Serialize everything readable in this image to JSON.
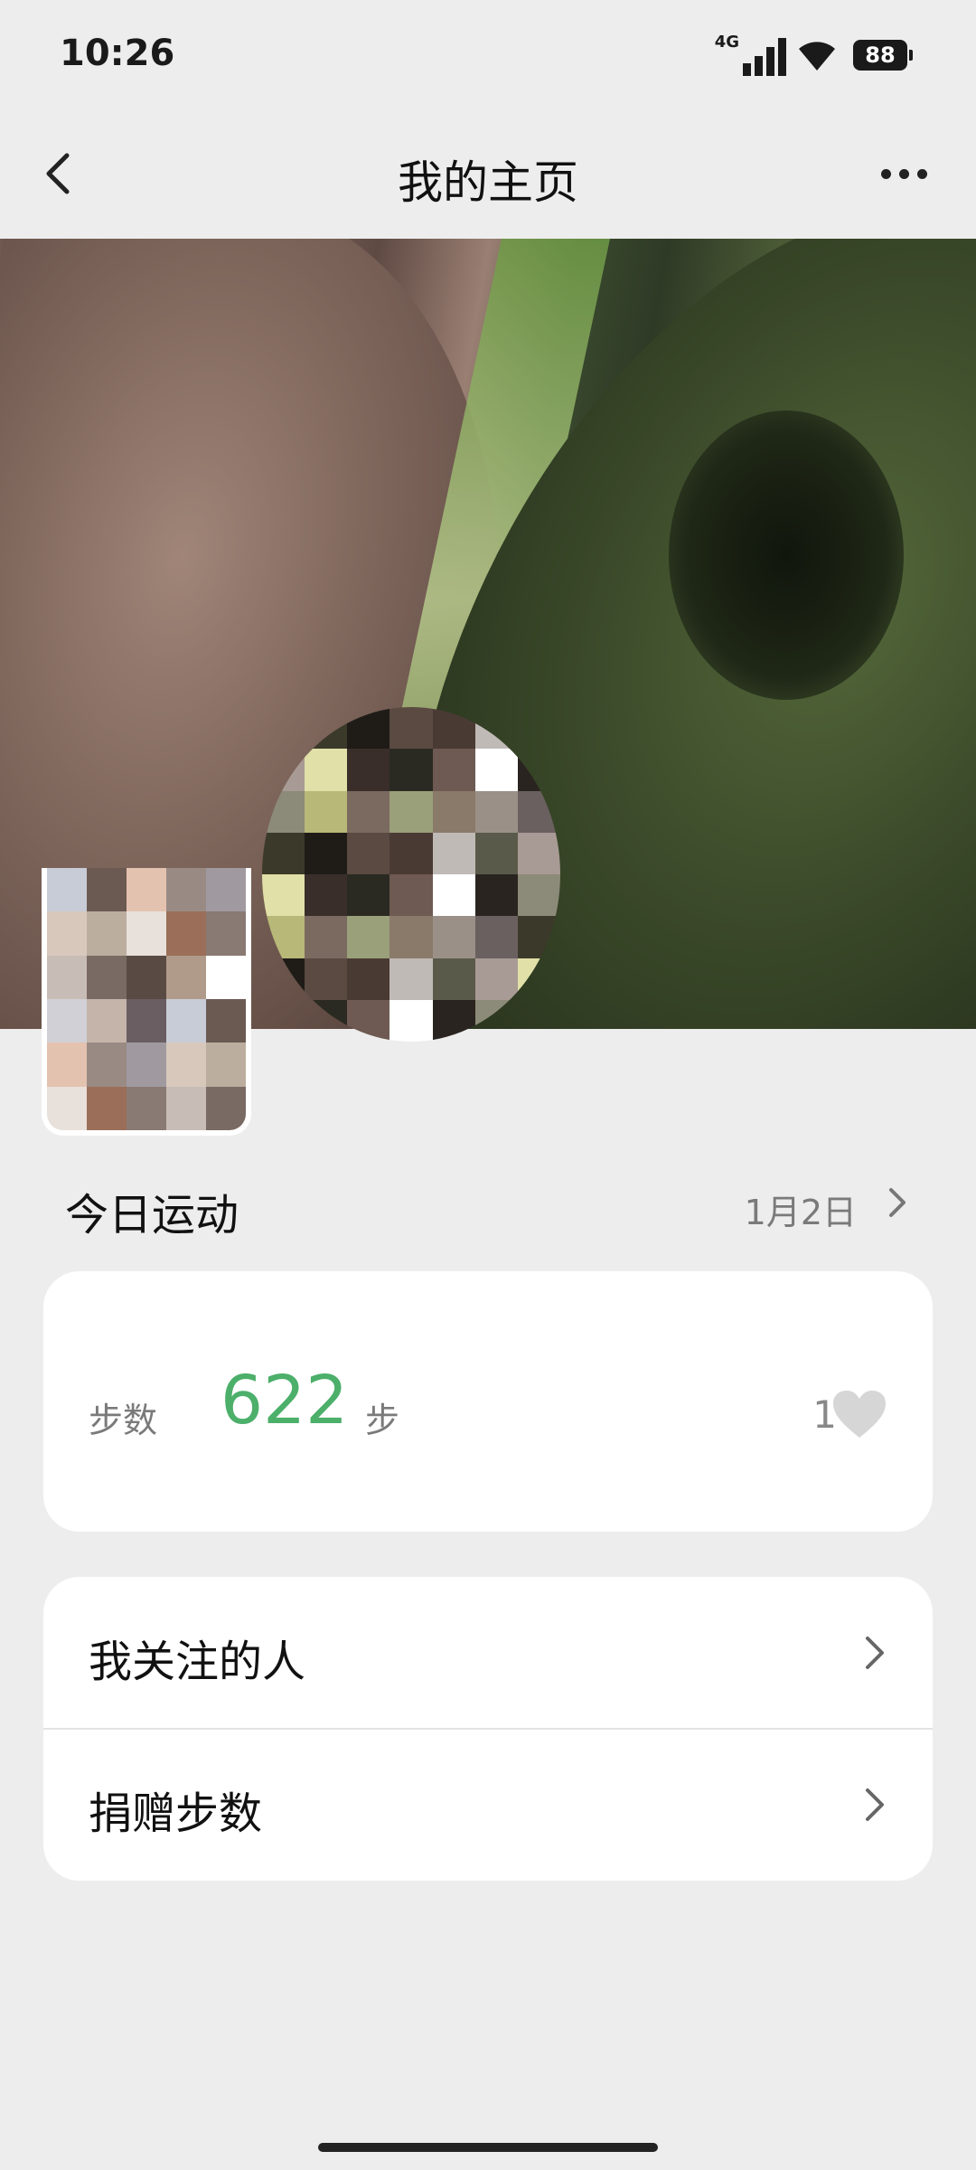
{
  "status_bar": {
    "time": "10:26",
    "network": "4G",
    "battery": "88"
  },
  "nav": {
    "title": "我的主页"
  },
  "section": {
    "title": "今日运动",
    "date": "1月2日"
  },
  "steps": {
    "label": "步数",
    "value": "622",
    "unit": "步",
    "likes": "1"
  },
  "menu": [
    {
      "label": "我关注的人"
    },
    {
      "label": "捐赠步数"
    }
  ],
  "colors": {
    "accent_green": "#4caf6a",
    "background": "#ededed",
    "card": "#ffffff"
  }
}
